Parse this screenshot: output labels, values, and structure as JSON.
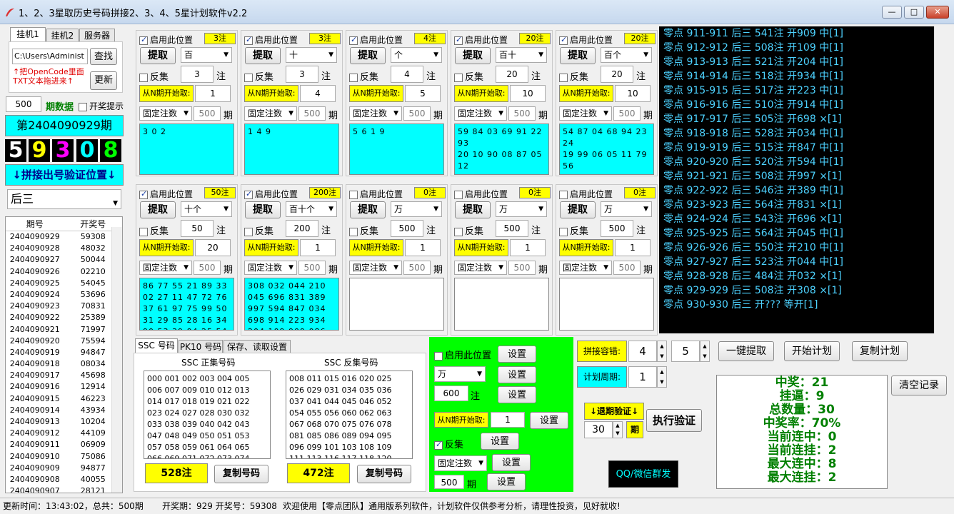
{
  "window": {
    "title": "1、2、3星取历史号码拼接2、3、4、5星计划软件v2.2",
    "min": "—",
    "max": "□",
    "close": "✕"
  },
  "left": {
    "tabs": [
      "挂机1",
      "挂机2",
      "服务器"
    ],
    "path": "C:\\Users\\Administ",
    "find_label": "查找",
    "hint": "↑把OpenCode里面\nTXT文本拖进来↑",
    "update_label": "更新",
    "period_count": "500",
    "period_data_label": "期数据",
    "lottery_hint_label": "开奖提示",
    "current_period": "第2404090929期",
    "digits": [
      "5",
      "9",
      "3",
      "0",
      "8"
    ],
    "digit_colors": [
      "#ffffff",
      "#ffff00",
      "#ff00ff",
      "#00ffff",
      "#00ff00"
    ],
    "verify_pos_label": "↓拼接出号验证位置↓",
    "position": "后三",
    "list_headers": [
      "期号",
      "开奖号"
    ],
    "rows": [
      [
        "2404090929",
        "59308"
      ],
      [
        "2404090928",
        "48032"
      ],
      [
        "2404090927",
        "50044"
      ],
      [
        "2404090926",
        "02210"
      ],
      [
        "2404090925",
        "54045"
      ],
      [
        "2404090924",
        "53696"
      ],
      [
        "2404090923",
        "70831"
      ],
      [
        "2404090922",
        "25389"
      ],
      [
        "2404090921",
        "71997"
      ],
      [
        "2404090920",
        "75594"
      ],
      [
        "2404090919",
        "94847"
      ],
      [
        "2404090918",
        "08034"
      ],
      [
        "2404090917",
        "45698"
      ],
      [
        "2404090916",
        "12914"
      ],
      [
        "2404090915",
        "46223"
      ],
      [
        "2404090914",
        "43934"
      ],
      [
        "2404090913",
        "10204"
      ],
      [
        "2404090912",
        "44109"
      ],
      [
        "2404090911",
        "06909"
      ],
      [
        "2404090910",
        "75086"
      ],
      [
        "2404090909",
        "94877"
      ],
      [
        "2404090908",
        "40055"
      ],
      [
        "2404090907",
        "28121"
      ]
    ]
  },
  "slot_labels": {
    "enable": "启用此位置",
    "extract": "提取",
    "reverse": "反集",
    "zhu": "注",
    "from": "从N期开始取:",
    "fixed": "固定注数",
    "qi": "期"
  },
  "slots": [
    {
      "enabled": true,
      "count": "3注",
      "pos": "百",
      "rev": "3",
      "from": "1",
      "fixed": "500",
      "text": "3 0 2"
    },
    {
      "enabled": true,
      "count": "3注",
      "pos": "十",
      "rev": "3",
      "from": "4",
      "fixed": "500",
      "text": "1 4 9"
    },
    {
      "enabled": true,
      "count": "4注",
      "pos": "个",
      "rev": "4",
      "from": "5",
      "fixed": "500",
      "text": "5 6 1 9"
    },
    {
      "enabled": true,
      "count": "20注",
      "pos": "百十",
      "rev": "20",
      "from": "10",
      "fixed": "500",
      "text": "59 84 03 69 91 22 93\n20 10 90 08 87 05 12\n78 58 43 60 94 67"
    },
    {
      "enabled": true,
      "count": "20注",
      "pos": "百个",
      "rev": "20",
      "from": "10",
      "fixed": "500",
      "text": "54 87 04 68 94 23 24\n19 99 06 05 11 79 56\n43 62 27 91 97 16"
    },
    {
      "enabled": true,
      "count": "50注",
      "pos": "十个",
      "rev": "50",
      "from": "20",
      "fixed": "500",
      "text": "86 77 55 21 89 33\n02 27 11 47 72 76\n37 61 97 75 99 50\n31 29 85 28 16 34\n90 53 39 04 25 54"
    },
    {
      "enabled": true,
      "count": "200注",
      "pos": "百十个",
      "rev": "200",
      "from": "1",
      "fixed": "500",
      "text": "308 032 044 210\n045 696 831 389\n997 594 847 034\n698 914 223 934\n204 109 909 086"
    },
    {
      "enabled": false,
      "count": "0注",
      "pos": "万",
      "rev": "500",
      "from": "1",
      "fixed": "500",
      "text": ""
    },
    {
      "enabled": false,
      "count": "0注",
      "pos": "万",
      "rev": "500",
      "from": "1",
      "fixed": "500",
      "text": ""
    },
    {
      "enabled": false,
      "count": "0注",
      "pos": "万",
      "rev": "500",
      "from": "1",
      "fixed": "500",
      "text": ""
    }
  ],
  "log": [
    "零点 911-911 后三 541注 开909 中[1]",
    "零点 912-912 后三 508注 开109 中[1]",
    "零点 913-913 后三 521注 开204 中[1]",
    "零点 914-914 后三 518注 开934 中[1]",
    "零点 915-915 后三 517注 开223 中[1]",
    "零点 916-916 后三 510注 开914 中[1]",
    "零点 917-917 后三 505注 开698 ×[1]",
    "零点 918-918 后三 528注 开034 中[1]",
    "零点 919-919 后三 515注 开847 中[1]",
    "零点 920-920 后三 520注 开594 中[1]",
    "零点 921-921 后三 508注 开997 ×[1]",
    "零点 922-922 后三 546注 开389 中[1]",
    "零点 923-923 后三 564注 开831 ×[1]",
    "零点 924-924 后三 543注 开696 ×[1]",
    "零点 925-925 后三 564注 开045 中[1]",
    "零点 926-926 后三 550注 开210 中[1]",
    "零点 927-927 后三 523注 开044 中[1]",
    "零点 928-928 后三 484注 开032 ×[1]",
    "零点 929-929 后三 508注 开308 ×[1]",
    "零点 930-930 后三 开???  等开[1]"
  ],
  "bottom": {
    "tabs": [
      "SSC 号码",
      "PK10 号码",
      "保存、读取设置"
    ],
    "pos_title": "SSC 正集号码",
    "neg_title": "SSC 反集号码",
    "pos_text": "000 001 002 003 004 005\n006 007 009 010 012 013\n014 017 018 019 021 022\n023 024 027 028 030 032\n033 038 039 040 042 043\n047 048 049 050 051 053\n057 058 059 061 064 065\n066 069 071 072 073 074",
    "neg_text": "008 011 015 016 020 025\n026 029 031 034 035 036\n037 041 044 045 046 052\n054 055 056 060 062 063\n067 068 070 075 076 078\n081 085 086 089 094 095\n096 099 101 103 108 109\n111 113 116 117 118 120",
    "pos_count": "528注",
    "neg_count": "472注",
    "copy_label": "复制号码"
  },
  "green": {
    "enable": "启用此位置",
    "set": "设置",
    "pos": "万",
    "zhu_val": "600",
    "zhu": "注",
    "from": "从N期开始取:",
    "from_val": "1",
    "rev": "反集",
    "fixed": "固定注数",
    "fixed_val": "500",
    "qi": "期"
  },
  "right": {
    "tol_label": "拼接容错:",
    "tol1": "4",
    "tol2": "5",
    "extract_all": "一键提取",
    "start_plan": "开始计划",
    "copy_plan": "复制计划",
    "cycle_label": "计划周期:",
    "cycle": "1",
    "back_label": "↓退期验证↓",
    "back_val": "30",
    "qi": "期",
    "verify": "执行验证",
    "qq": "QQ/微信群发",
    "clear": "清空记录",
    "stats": [
      "中奖：21",
      "挂逼：9",
      "总数量：30",
      "中奖率：70%",
      "当前连中：0",
      "当前连挂：2",
      "最大连中：8",
      "最大连挂：2"
    ]
  },
  "status": {
    "updated": "更新时间：13:43:02，总共：500期",
    "lottery": "开奖期：929 开奖号：59308",
    "welcome": "欢迎使用【零点团队】通用版系列软件，计划软件仅供参考分析，请理性投资，见好就收!"
  }
}
